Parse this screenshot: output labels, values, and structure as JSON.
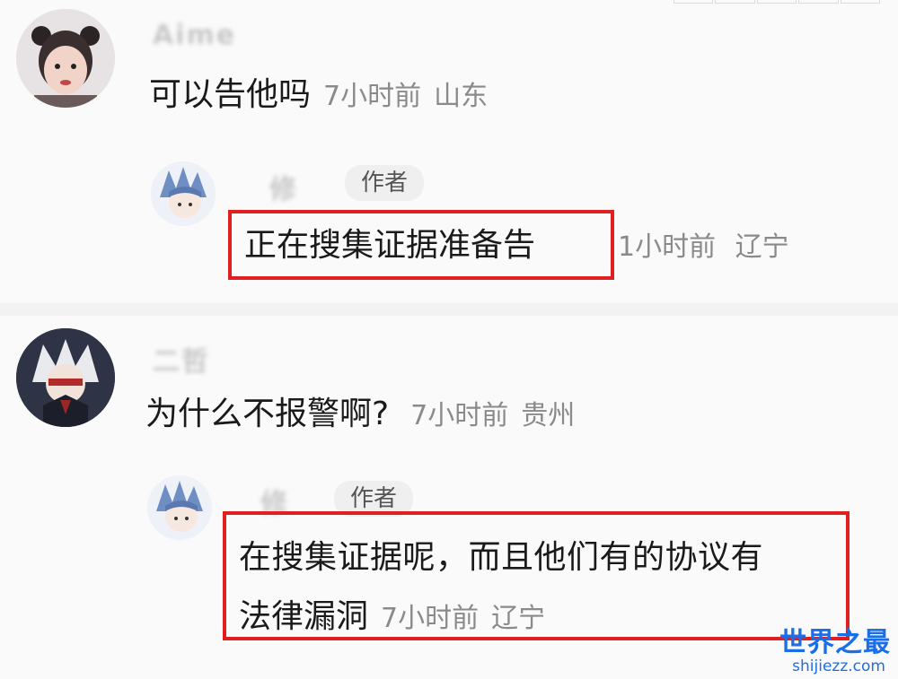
{
  "comments": [
    {
      "username": "Aime",
      "text": "可以告他吗",
      "time": "7小时前",
      "location": "山东",
      "reply": {
        "username": "修",
        "badge": "作者",
        "text": "正在搜集证据准备告",
        "time": "1小时前",
        "location": "辽宁"
      }
    },
    {
      "username": "二哲",
      "text": "为什么不报警啊?",
      "time": "7小时前",
      "location": "贵州",
      "reply": {
        "username": "修",
        "badge": "作者",
        "text_line1": "在搜集证据呢，而且他们有的协议有",
        "text_line2": "法律漏洞",
        "time": "7小时前",
        "location": "辽宁"
      }
    }
  ],
  "watermark": {
    "title": "世界之最",
    "url": "shijiezz.com"
  },
  "colors": {
    "highlight": "#e02020",
    "watermark": "#1a6fe8",
    "meta": "#8a8a8a"
  }
}
